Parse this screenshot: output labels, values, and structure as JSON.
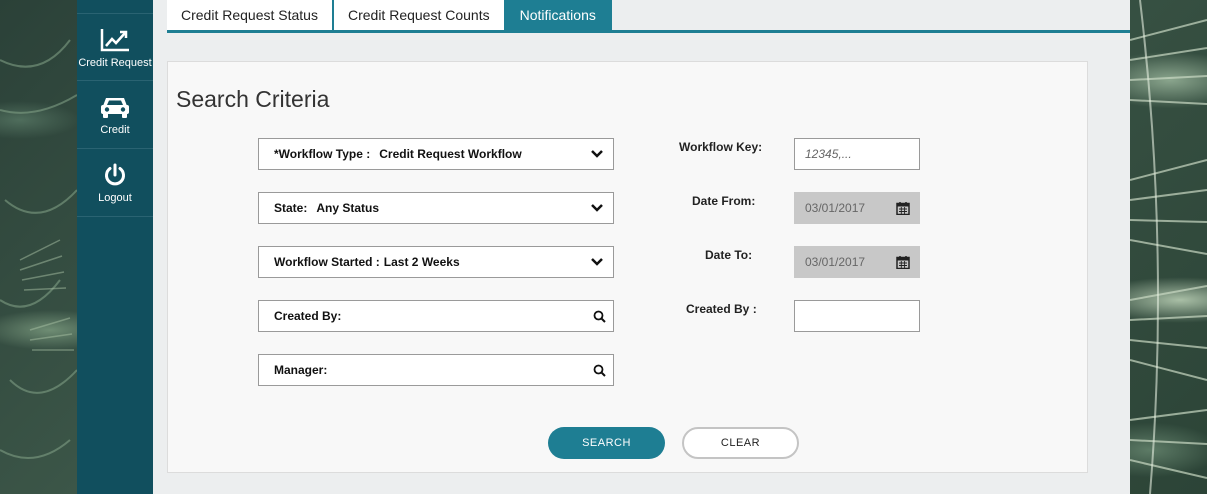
{
  "sidebar": {
    "items": [
      {
        "label": "Credit Request",
        "icon": "line-chart-icon"
      },
      {
        "label": "Credit",
        "icon": "car-icon"
      },
      {
        "label": "Logout",
        "icon": "power-icon"
      }
    ]
  },
  "tabs": [
    {
      "label": "Credit Request Status",
      "active": false
    },
    {
      "label": "Credit Request Counts",
      "active": false
    },
    {
      "label": "Notifications",
      "active": true
    }
  ],
  "search": {
    "title": "Search Criteria",
    "workflow_type": {
      "label": "*Workflow Type :",
      "value": "Credit Request Workflow"
    },
    "state": {
      "label": "State:",
      "value": "Any Status"
    },
    "workflow_started": {
      "label": "Workflow Started :",
      "value": "Last 2 Weeks"
    },
    "created_by_lookup": {
      "label": "Created By:"
    },
    "manager_lookup": {
      "label": "Manager:"
    },
    "workflow_key": {
      "label": "Workflow Key:",
      "placeholder": "12345,..."
    },
    "date_from": {
      "label": "Date From:",
      "value": "03/01/2017"
    },
    "date_to": {
      "label": "Date To:",
      "value": "03/01/2017"
    },
    "created_by": {
      "label": "Created By :",
      "value": ""
    },
    "search_button": "SEARCH",
    "clear_button": "CLEAR"
  },
  "colors": {
    "sidebar": "#114f5e",
    "accent": "#1e7e93",
    "date_field": "#c8c8c8"
  }
}
